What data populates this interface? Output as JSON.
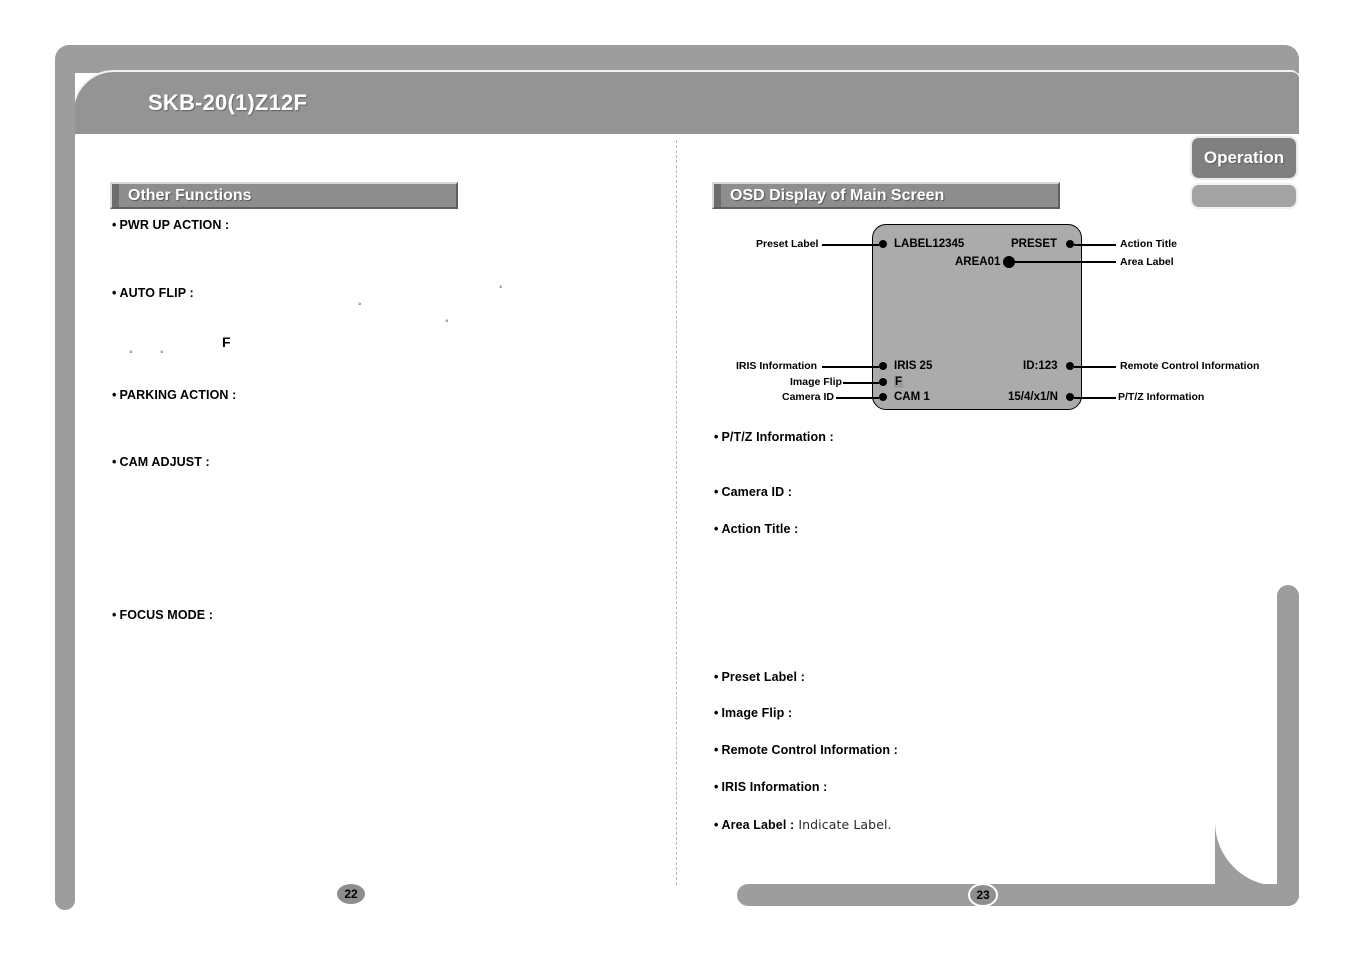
{
  "document": {
    "header_title": "SKB-20(1)Z12F",
    "side_tab_active": "Operation",
    "side_tab_inactive": ""
  },
  "left_page": {
    "page_number": "22",
    "section_title": "Other Functions",
    "bullets": [
      {
        "label": "PWR UP ACTION :"
      },
      {
        "label": "AUTO FLIP :"
      },
      {
        "label": "PARKING ACTION :"
      },
      {
        "label": "CAM ADJUST :"
      },
      {
        "label": "FOCUS MODE :"
      }
    ],
    "stray_glyphs": {
      "f_marker": "F",
      "degree": "°"
    }
  },
  "right_page": {
    "page_number": "23",
    "section_title": "OSD Display of Main Screen",
    "osd_screen": {
      "preset_label": "LABEL12345",
      "action_title": "PRESET",
      "area_label": "AREA01",
      "iris_information": "IRIS  25",
      "remote_control_information": "ID:123",
      "image_flip": "F",
      "camera_id": "CAM  1",
      "ptz_information": "15/4/x1/N"
    },
    "callouts": {
      "preset_label": "Preset Label",
      "action_title": "Action Title",
      "area_label": "Area Label",
      "iris_information": "IRIS Information",
      "remote_control_information": "Remote Control Information",
      "image_flip": "Image Flip",
      "camera_id": "Camera ID",
      "ptz_information": "P/T/Z Information"
    },
    "bullets": [
      {
        "label": "P/T/Z Information :",
        "value": ""
      },
      {
        "label": "Camera ID :",
        "value": ""
      },
      {
        "label": "Action Title :",
        "value": ""
      },
      {
        "label": "Preset Label :",
        "value": ""
      },
      {
        "label": "Image Flip :",
        "value": ""
      },
      {
        "label": "Remote Control Information :",
        "value": ""
      },
      {
        "label": "IRIS Information :",
        "value": ""
      },
      {
        "label": "Area Label :",
        "value": "Indicate Label."
      }
    ]
  },
  "colors": {
    "frame_gray": "#9d9d9d",
    "header_gray": "#949494",
    "section_bar": "#8e8e8e",
    "osd_fill": "#ababab",
    "tab_active": "#808080"
  }
}
